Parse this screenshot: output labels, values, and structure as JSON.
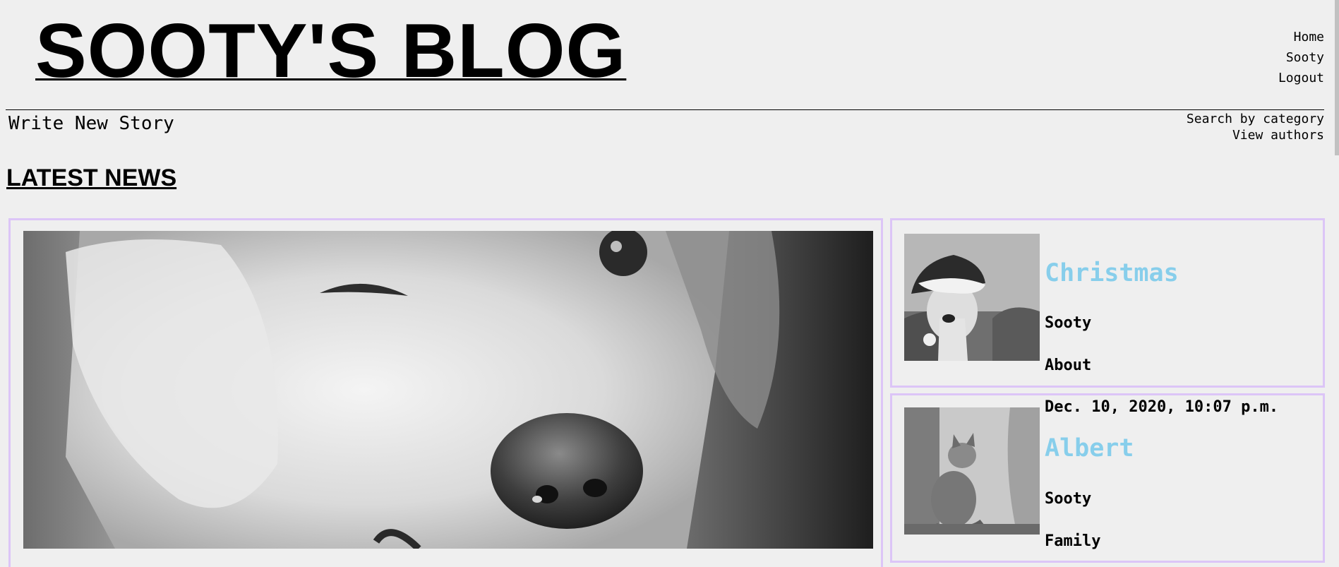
{
  "header": {
    "site_title": "SOOTY'S BLOG",
    "nav": [
      "Home",
      "Sooty",
      "Logout"
    ]
  },
  "subheader": {
    "write_link": "Write New Story",
    "links": [
      "Search by category",
      "View authors"
    ]
  },
  "section_title": "LATEST NEWS",
  "stories": [
    {
      "date": "",
      "title": "Christmas",
      "author": "Sooty",
      "category": "About",
      "thumb": "dog-in-santa-hat-photo"
    },
    {
      "date": "Dec. 10, 2020, 10:07 p.m.",
      "title": "Albert",
      "author": "Sooty",
      "category": "Family",
      "thumb": "kitten-photo"
    }
  ],
  "feature": {
    "image": "dog-closeup-photo"
  },
  "colors": {
    "background": "#efefef",
    "card_border": "#dcc5f7",
    "story_title": "#87ceeb"
  }
}
